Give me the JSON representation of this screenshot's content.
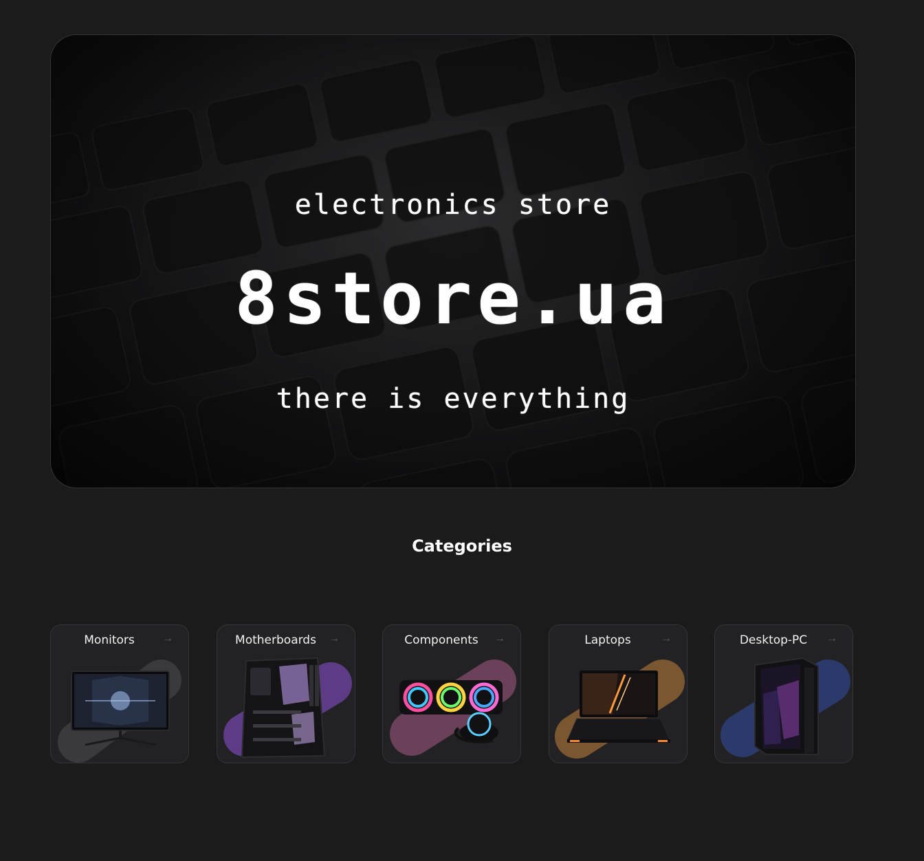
{
  "hero": {
    "subtitle": "electronics store",
    "title": "8store.ua",
    "tagline": "there is everything"
  },
  "categories": {
    "heading": "Categories",
    "items": [
      {
        "label": "Monitors",
        "arrow": "→",
        "blob_color": "#3a3a3e"
      },
      {
        "label": "Motherboards",
        "arrow": "→",
        "blob_color": "#5d3b86"
      },
      {
        "label": "Components",
        "arrow": "→",
        "blob_color": "#6a4159"
      },
      {
        "label": "Laptops",
        "arrow": "→",
        "blob_color": "#7a5631"
      },
      {
        "label": "Desktop-PC",
        "arrow": "→",
        "blob_color": "#2b3a6b"
      }
    ]
  },
  "colors": {
    "background": "#1b1b1c",
    "card": "#222224",
    "border": "#34343a"
  }
}
